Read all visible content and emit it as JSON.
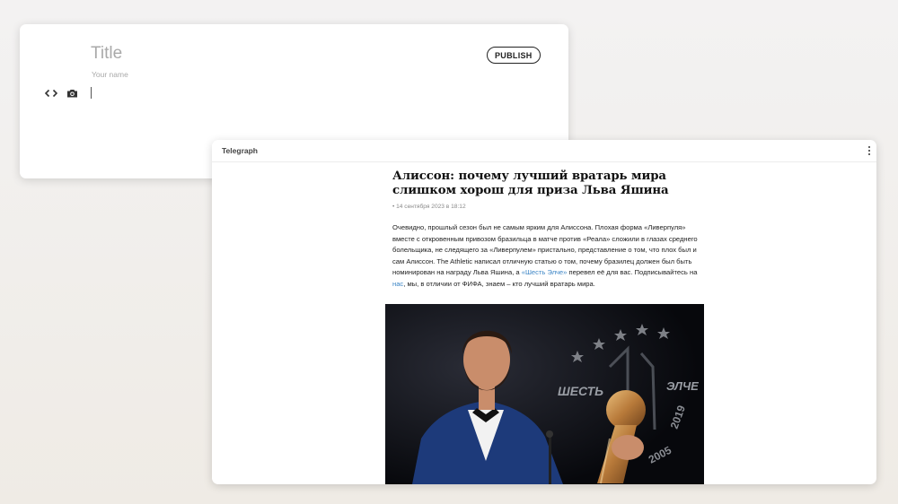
{
  "editor": {
    "title_placeholder": "Title",
    "author_placeholder": "Your name",
    "publish_label": "PUBLISH",
    "tools": [
      {
        "icon": "code-icon"
      },
      {
        "icon": "camera-icon"
      }
    ]
  },
  "telegraph": {
    "brand": "Telegraph",
    "menu_icon": "more-vertical-icon",
    "article": {
      "title": "Алиссон: почему лучший вратарь мира слишком хорош для приза Льва Яшина",
      "date": "• 14 сентября 2023 в 18:12",
      "paragraph": {
        "part1": "Очевидно, прошлый сезон был не самым ярким для Алиссона. Плохая форма «Ливерпуля» вместе с откровенным привозом бразильца в матче против «Реала» сложили в глазах среднего болельщика, не следящего за «Ливерпулем» пристально, представление о том, что плох был и сам Алиссон. The Athletic написал отличную статью о том, почему бразилец должен был быть номинирован на награду Льва Яшина, а ",
        "link1": "«Шесть Элче»",
        "part2": " перевел её для вас. Подписывайтесь на ",
        "link2": "нас",
        "part3": ", мы, в отличии от ФИФА, знаем – кто лучший вратарь мира."
      },
      "image": {
        "banner_text_left": "ШЕСТЬ",
        "banner_text_right": "ЭЛЧЕ",
        "year_start": "2005",
        "year_end": "2019"
      }
    }
  },
  "colors": {
    "link": "#3d86c6",
    "photo_bg": "#0f1218",
    "suit": "#1d3a7a"
  }
}
